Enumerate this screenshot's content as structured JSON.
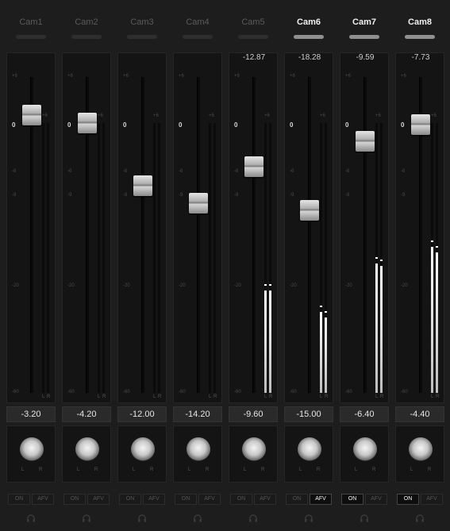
{
  "scale_labels": {
    "plus6": "+6",
    "zero": "0",
    "minus6": "-6",
    "minus9": "-9",
    "minus20": "-20",
    "minus60": "-60"
  },
  "meter_labels": {
    "left": "L",
    "right": "R"
  },
  "balance_labels": {
    "left": "L",
    "right": "R"
  },
  "channels": [
    {
      "name": "Cam1",
      "active": false,
      "peak": "",
      "gain": "-3.20",
      "on_label": "ON",
      "afv_label": "AFV",
      "on_lit": false,
      "afv_lit": false,
      "fader_level": -3.2,
      "meter_left": 0,
      "meter_right": 0
    },
    {
      "name": "Cam2",
      "active": false,
      "peak": "",
      "gain": "-4.20",
      "on_label": "ON",
      "afv_label": "AFV",
      "on_lit": false,
      "afv_lit": false,
      "fader_level": -4.2,
      "meter_left": 0,
      "meter_right": 0
    },
    {
      "name": "Cam3",
      "active": false,
      "peak": "",
      "gain": "-12.00",
      "on_label": "ON",
      "afv_label": "AFV",
      "on_lit": false,
      "afv_lit": false,
      "fader_level": -12.0,
      "meter_left": 0,
      "meter_right": 0
    },
    {
      "name": "Cam4",
      "active": false,
      "peak": "",
      "gain": "-14.20",
      "on_label": "ON",
      "afv_label": "AFV",
      "on_lit": false,
      "afv_lit": false,
      "fader_level": -14.2,
      "meter_left": 0,
      "meter_right": 0
    },
    {
      "name": "Cam5",
      "active": false,
      "peak": "-12.87",
      "gain": "-9.60",
      "on_label": "ON",
      "afv_label": "AFV",
      "on_lit": false,
      "afv_lit": false,
      "fader_level": -9.6,
      "meter_left": 0.38,
      "meter_right": 0.38
    },
    {
      "name": "Cam6",
      "active": true,
      "peak": "-18.28",
      "gain": "-15.00",
      "on_label": "ON",
      "afv_label": "AFV",
      "on_lit": false,
      "afv_lit": true,
      "fader_level": -15.0,
      "meter_left": 0.3,
      "meter_right": 0.28
    },
    {
      "name": "Cam7",
      "active": true,
      "peak": "-9.59",
      "gain": "-6.40",
      "on_label": "ON",
      "afv_label": "AFV",
      "on_lit": true,
      "afv_lit": false,
      "fader_level": -6.4,
      "meter_left": 0.48,
      "meter_right": 0.47
    },
    {
      "name": "Cam8",
      "active": true,
      "peak": "-7.73",
      "gain": "-4.40",
      "on_label": "ON",
      "afv_label": "AFV",
      "on_lit": true,
      "afv_lit": false,
      "fader_level": -4.4,
      "meter_left": 0.54,
      "meter_right": 0.52
    }
  ]
}
